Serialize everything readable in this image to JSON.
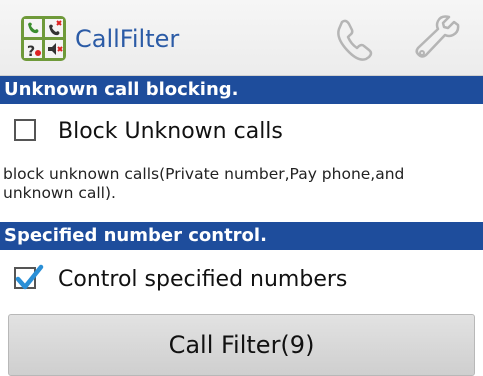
{
  "actionbar": {
    "title": "CallFilter",
    "app_icon": "callfilter-app-icon",
    "actions": [
      {
        "icon": "phone-icon"
      },
      {
        "icon": "wrench-icon"
      }
    ]
  },
  "sections": [
    {
      "header": "Unknown call blocking.",
      "checkbox": {
        "label": "Block Unknown calls",
        "checked": false
      },
      "description": "block unknown calls(Private number,Pay phone,and unknown call)."
    },
    {
      "header": "Specified number control.",
      "checkbox": {
        "label": "Control specified numbers",
        "checked": true
      }
    }
  ],
  "filter_button": {
    "label": "Call Filter(9)"
  },
  "colors": {
    "header_bg": "#1e4d9c",
    "title": "#2b5ba6",
    "check": "#2a8fd6"
  }
}
